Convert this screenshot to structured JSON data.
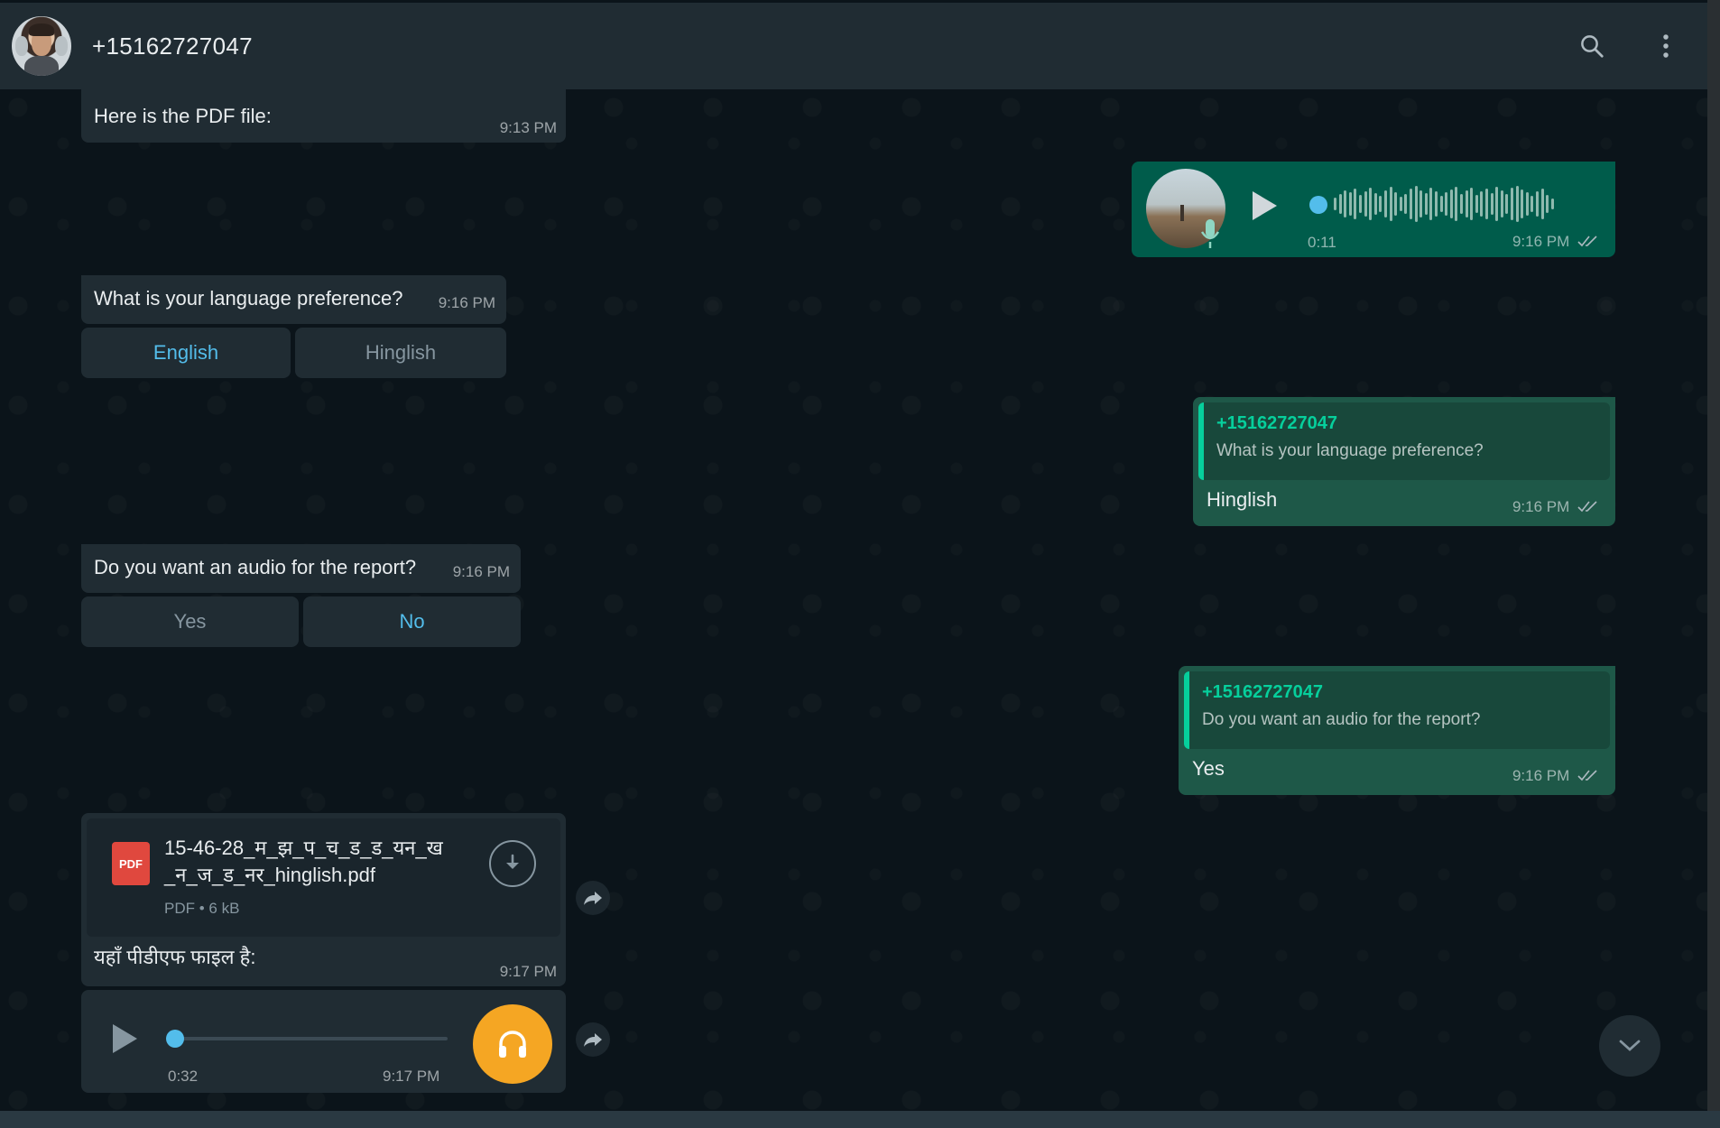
{
  "header": {
    "contact_name": "+15162727047",
    "icons": [
      "search-icon",
      "menu-dots-icon"
    ]
  },
  "messages": {
    "pdf_intro": {
      "text": "Here is the PDF file:",
      "time": "9:13 PM"
    },
    "voice_out": {
      "duration": "0:11",
      "time": "9:16 PM"
    },
    "lang_question": {
      "text": "What is your language preference?",
      "time": "9:16 PM",
      "options": [
        "English",
        "Hinglish"
      ]
    },
    "lang_reply": {
      "quote_name": "+15162727047",
      "quote_text": "What is your language preference?",
      "text": "Hinglish",
      "time": "9:16 PM"
    },
    "audio_question": {
      "text": "Do you want an audio for the report?",
      "time": "9:16 PM",
      "options": [
        "Yes",
        "No"
      ]
    },
    "audio_reply": {
      "quote_name": "+15162727047",
      "quote_text": "Do you want an audio for the report?",
      "text": "Yes",
      "time": "9:16 PM"
    },
    "pdf_file": {
      "icon_label": "PDF",
      "name_line1": "15-46-28_म_झ_प_च_ड_ड_यन_ख",
      "name_line2": "_न_ज_ड_नर_hinglish.pdf",
      "meta": "PDF • 6 kB",
      "caption": "यहाँ पीडीएफ फाइल है:",
      "time": "9:17 PM"
    },
    "audio_in": {
      "duration": "0:32",
      "time": "9:17 PM"
    }
  },
  "colors": {
    "incoming": "#202c33",
    "outgoing": "#005c4b",
    "accent": "#53bdeb",
    "quote_accent": "#06cf9c",
    "headphones": "#f5a623"
  }
}
